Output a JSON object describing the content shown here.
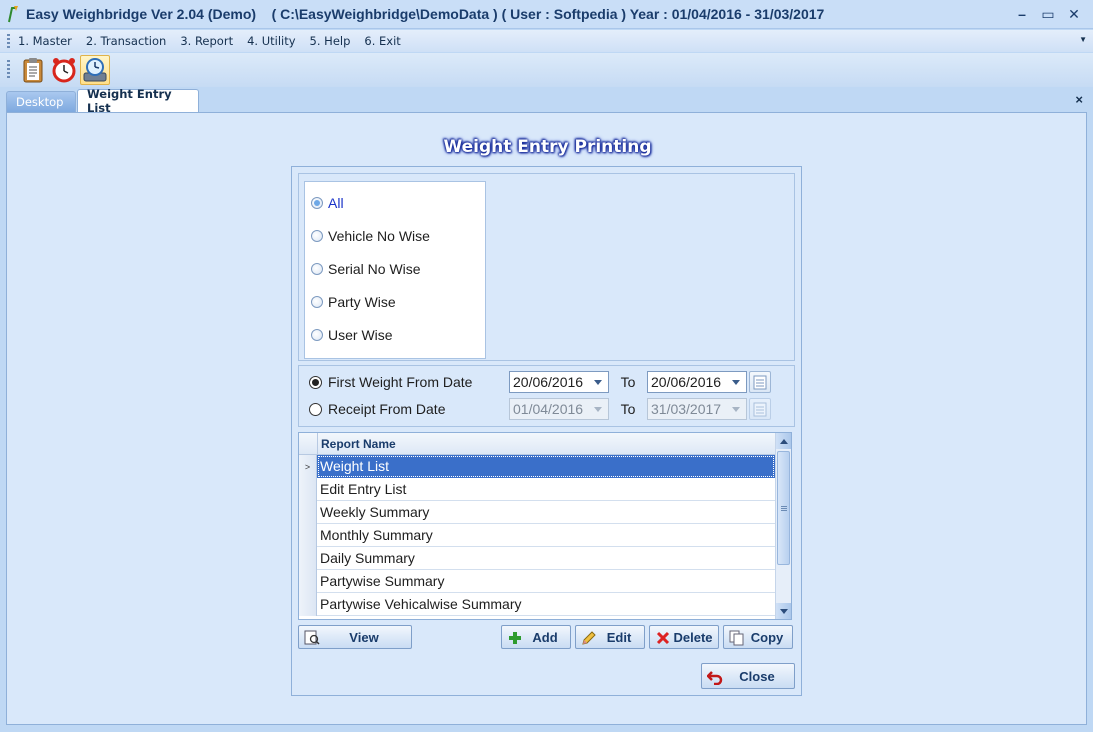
{
  "window": {
    "title": "Easy Weighbridge Ver 2.04 (Demo)    ( C:\\EasyWeighbridge\\DemoData ) ( User : Softpedia ) Year : 01/04/2016 - 31/03/2017",
    "minimize": "–",
    "restore": "▭",
    "close": "✕"
  },
  "menu": {
    "items": [
      "1. Master",
      "2. Transaction",
      "3. Report",
      "4. Utility",
      "5. Help",
      "6. Exit"
    ]
  },
  "toolbar": {
    "buttons": [
      "clipboard-icon",
      "alarm-clock-icon",
      "backup-icon"
    ]
  },
  "tabs": {
    "items": [
      {
        "label": "Desktop",
        "active": false
      },
      {
        "label": "Weight Entry List",
        "active": true
      }
    ],
    "close": "×"
  },
  "form": {
    "heading": "Weight Entry Printing",
    "filter_options": [
      {
        "label": "All",
        "selected": true
      },
      {
        "label": "Vehicle No Wise",
        "selected": false
      },
      {
        "label": "Serial No Wise",
        "selected": false
      },
      {
        "label": "Party Wise",
        "selected": false
      },
      {
        "label": "User Wise",
        "selected": false
      }
    ],
    "date_rows": [
      {
        "label": "First Weight From Date",
        "selected": true,
        "from": "20/06/2016",
        "to_label": "To",
        "to": "20/06/2016",
        "enabled": true
      },
      {
        "label": "Receipt From Date",
        "selected": false,
        "from": "01/04/2016",
        "to_label": "To",
        "to": "31/03/2017",
        "enabled": false
      }
    ],
    "grid": {
      "column": "Report Name",
      "rows": [
        {
          "name": "Weight List",
          "selected": true
        },
        {
          "name": "Edit Entry List",
          "selected": false
        },
        {
          "name": "Weekly Summary",
          "selected": false
        },
        {
          "name": "Monthly Summary",
          "selected": false
        },
        {
          "name": "Daily Summary",
          "selected": false
        },
        {
          "name": "Partywise Summary",
          "selected": false
        },
        {
          "name": "Partywise Vehicalwise Summary",
          "selected": false
        }
      ]
    },
    "buttons": {
      "view": "View",
      "add": "Add",
      "edit": "Edit",
      "delete": "Delete",
      "copy": "Copy",
      "close": "Close"
    }
  },
  "colors": {
    "selection": "#3a6fc9",
    "heading_glow": "#1b2f9b"
  }
}
